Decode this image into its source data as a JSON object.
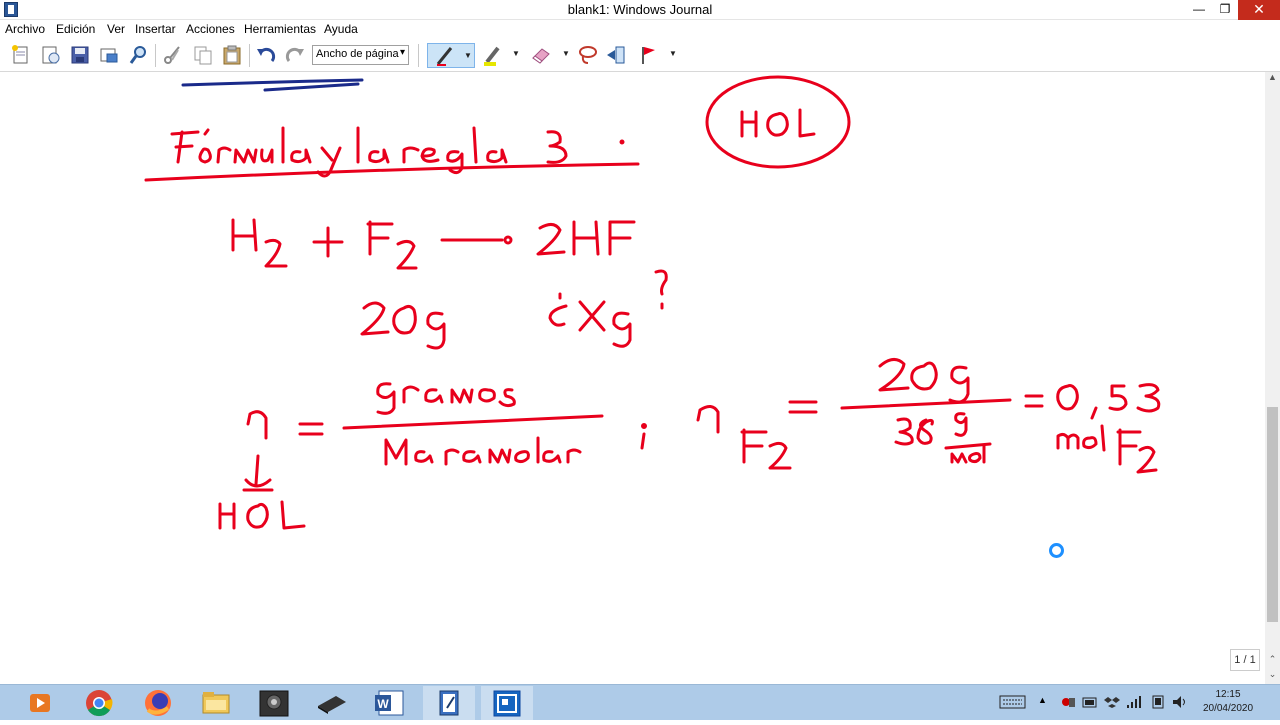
{
  "window": {
    "title": "blank1: Windows Journal"
  },
  "menu": [
    "Archivo",
    "Edición",
    "Ver",
    "Insertar",
    "Acciones",
    "Herramientas",
    "Ayuda"
  ],
  "toolbar": {
    "zoom_value": "Ancho de página"
  },
  "ink_color": "#e8001c",
  "status": {
    "page_indicator": "1 / 1"
  },
  "taskbar": {
    "time": "12:15",
    "date": "20/04/2020"
  }
}
